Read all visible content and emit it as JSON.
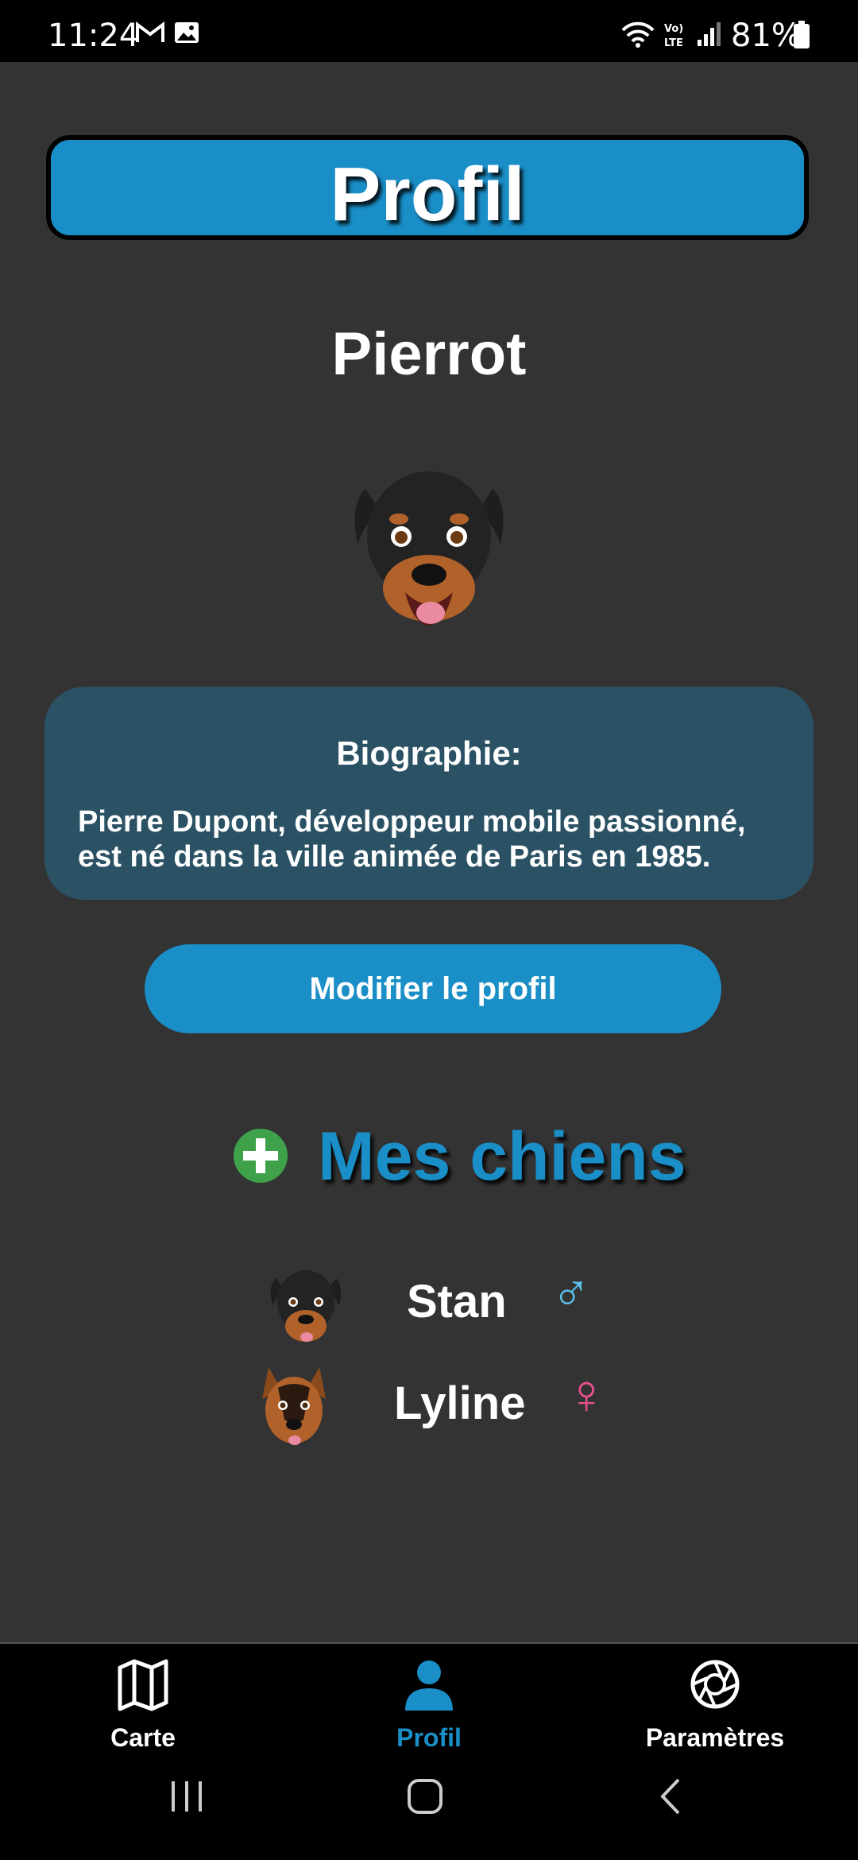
{
  "status_bar": {
    "time": "11:24",
    "battery": "81%",
    "network": "LTE"
  },
  "header": {
    "title": "Profil"
  },
  "user": {
    "name": "Pierrot",
    "avatar_icon": "rottweiler-avatar"
  },
  "bio": {
    "title": "Biographie:",
    "text": "Pierre Dupont, développeur mobile passionné, est né dans la ville animée de Paris en 1985."
  },
  "edit_button": {
    "label": "Modifier le profil"
  },
  "dogs": {
    "title": "Mes chiens",
    "add_icon": "plus-circle-icon",
    "list": [
      {
        "name": "Stan",
        "sex": "male",
        "sex_symbol": "♂",
        "sex_color": "#5bc0e8",
        "avatar_icon": "rottweiler-avatar"
      },
      {
        "name": "Lyline",
        "sex": "female",
        "sex_symbol": "♀",
        "sex_color": "#e8508f",
        "avatar_icon": "german-shepherd-avatar"
      }
    ]
  },
  "bottom_nav": {
    "items": [
      {
        "label": "Carte",
        "icon": "map-icon",
        "active": false
      },
      {
        "label": "Profil",
        "icon": "person-icon",
        "active": true
      },
      {
        "label": "Paramètres",
        "icon": "aperture-icon",
        "active": false
      }
    ]
  },
  "colors": {
    "accent": "#1a8ec7",
    "background": "#333333",
    "bio_card": "#2b5264",
    "add_green": "#3fa24a"
  }
}
